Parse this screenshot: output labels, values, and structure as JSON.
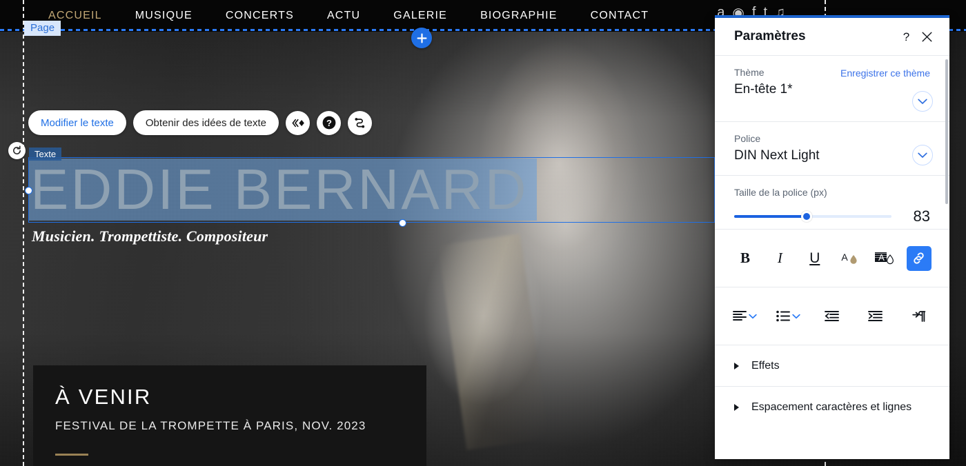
{
  "site": {
    "nav": [
      {
        "label": "ACCUEIL",
        "active": true
      },
      {
        "label": "MUSIQUE",
        "active": false
      },
      {
        "label": "CONCERTS",
        "active": false
      },
      {
        "label": "ACTU",
        "active": false
      },
      {
        "label": "GALERIE",
        "active": false
      },
      {
        "label": "BIOGRAPHIE",
        "active": false
      },
      {
        "label": "CONTACT",
        "active": false
      }
    ],
    "social": [
      "amazon-icon",
      "spotify-icon",
      "facebook-icon",
      "twitter-icon",
      "apple-music-icon"
    ],
    "hero": {
      "title": "EDDIE BERNARD",
      "subtitle": "Musicien. Trompettiste. Compositeur"
    },
    "upcoming_card": {
      "title": "À VENIR",
      "subtitle": "FESTIVAL DE LA TROMPETTE À PARIS, NOV. 2023"
    }
  },
  "editor": {
    "page_badge": "Page",
    "element_tag": "Texte",
    "add_section_icon": "plus-icon",
    "rotate_icon": "rotate-icon",
    "toolbar": {
      "edit_text_label": "Modifier le texte",
      "text_ideas_label": "Obtenir des idées de texte",
      "animation_icon": "animation-icon",
      "help_icon": "help-circle-icon",
      "link_icon": "connect-icon"
    }
  },
  "panel": {
    "title": "Paramètres",
    "help_icon": "question-mark-icon",
    "close_icon": "close-icon",
    "theme": {
      "label": "Thème",
      "value": "En-tête 1*",
      "save_link": "Enregistrer ce thème",
      "chevron_icon": "chevron-down-icon"
    },
    "font": {
      "label": "Police",
      "value": "DIN Next Light",
      "chevron_icon": "chevron-down-icon"
    },
    "font_size": {
      "label": "Taille de la police (px)",
      "value": "83",
      "min": 0,
      "max": 180,
      "percent": 46
    },
    "format_buttons": [
      {
        "name": "bold-icon",
        "glyph": "B",
        "active": false
      },
      {
        "name": "italic-icon",
        "glyph": "I",
        "active": false
      },
      {
        "name": "underline-icon",
        "glyph": "U",
        "active": false
      },
      {
        "name": "text-color-icon",
        "glyph": "",
        "active": false
      },
      {
        "name": "text-highlight-icon",
        "glyph": "",
        "active": false
      },
      {
        "name": "link-icon",
        "glyph": "",
        "active": true
      }
    ],
    "paragraph_buttons": [
      {
        "name": "text-align-icon",
        "has_chevron": true
      },
      {
        "name": "bulleted-list-icon",
        "has_chevron": true
      },
      {
        "name": "decrease-indent-icon",
        "has_chevron": false
      },
      {
        "name": "increase-indent-icon",
        "has_chevron": false
      },
      {
        "name": "text-direction-icon",
        "has_chevron": false
      }
    ],
    "accordions": [
      {
        "label": "Effets"
      },
      {
        "label": "Espacement caractères et lignes"
      }
    ]
  },
  "colors": {
    "accent_blue": "#1f6fe5",
    "link_blue": "#3b72e8",
    "gold": "#c2a476",
    "panel_bg": "#ffffff",
    "site_bg": "#060606"
  }
}
